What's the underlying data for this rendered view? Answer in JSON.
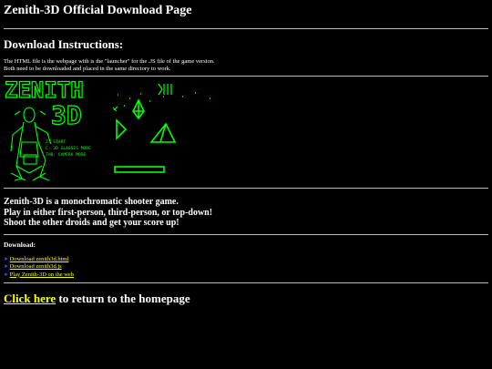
{
  "page_title": "Zenith-3D Official Download Page",
  "instructions": {
    "heading": "Download Instructions:",
    "line1": "The HTML file is the webpage with is the \"launcher\" for the .JS file of the game version.",
    "line2": "Both need to be downloaded and placed in the same directory to work."
  },
  "banner": {
    "logo_line1": "ZENITH",
    "logo_line2": "3D",
    "menu": [
      "Z: START",
      "C: 3D GLASSES MODE",
      "TAB: CAMERA MODE"
    ],
    "color": "#00ff00"
  },
  "description": {
    "line1": "Zenith-3D is a monochromatic shooter game.",
    "line2": "Play in either first-person, third-person, or top-down!",
    "line3": "Shoot the other droids and get your score up!"
  },
  "downloads": {
    "heading": "Download:",
    "links": [
      {
        "arrow": "➤",
        "label": "Download zenith3d.html"
      },
      {
        "arrow": "➤",
        "label": "Download zenith3d.js"
      },
      {
        "arrow": "➤",
        "label": "Play Zenith-3D on the web"
      }
    ]
  },
  "homepage": {
    "link_text": "Click here",
    "suffix": " to return to the homepage"
  },
  "colors": {
    "background": "#000000",
    "text": "#ffffff",
    "link": "#ffff00",
    "arrow": "#3b5bff",
    "game_green": "#00ff00"
  }
}
